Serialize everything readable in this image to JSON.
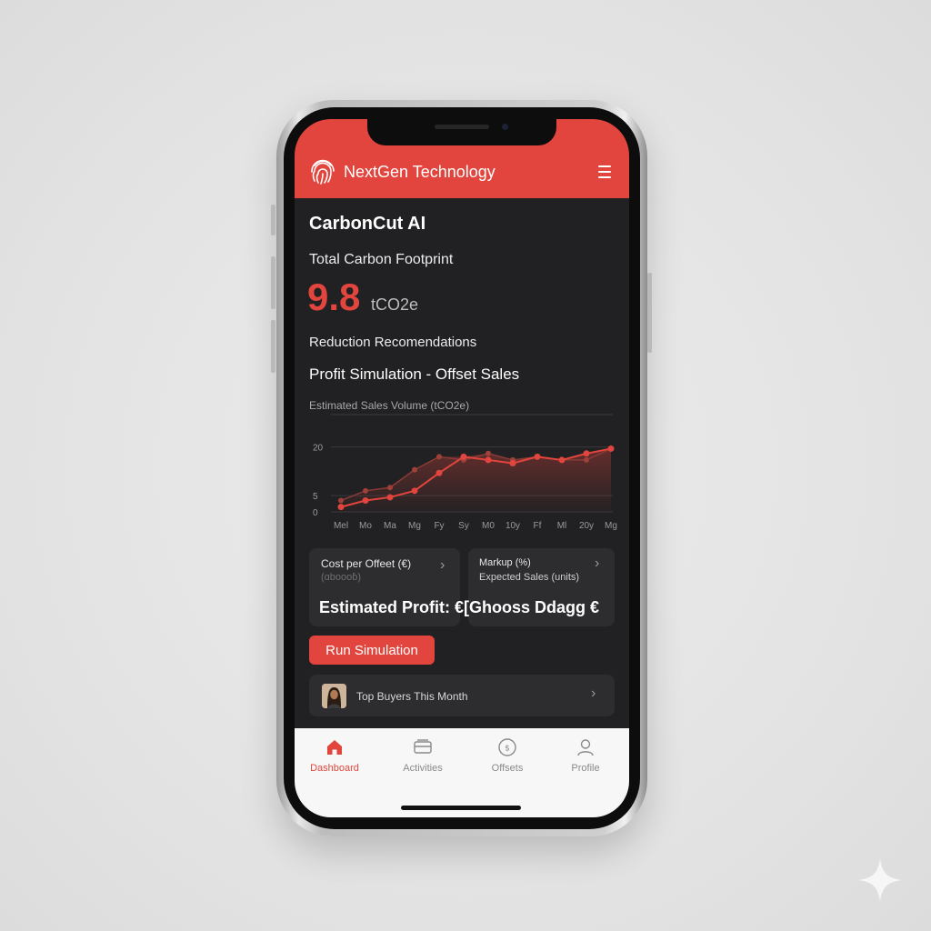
{
  "header": {
    "brand": "NextGen Technology",
    "brand_color": "#e2453d"
  },
  "app": {
    "title": "CarbonCut AI"
  },
  "footprint": {
    "label": "Total Carbon Footprint",
    "value": "9.8",
    "unit": "tCO2e"
  },
  "sections": {
    "reduction": "Reduction Recomendations",
    "simulation_title": "Profit Simulation - Offset Sales"
  },
  "chart_data": {
    "type": "line",
    "title": "",
    "ylabel": "Estimated Sales Volume (tCO2e)",
    "xlabel": "",
    "categories": [
      "Mel",
      "Mo",
      "Ma",
      "Mg",
      "Fy",
      "Sy",
      "M0",
      "10y",
      "Ff",
      "Ml",
      "20y",
      "Mg"
    ],
    "y_ticks": [
      "20",
      "5",
      "0"
    ],
    "ylim": [
      0,
      30
    ],
    "grid": true,
    "series": [
      {
        "values": [
          1.5,
          3.5,
          4.5,
          6.5,
          12,
          17,
          16,
          15,
          17,
          16,
          18,
          19.5
        ]
      },
      {
        "values": [
          3.5,
          6.5,
          7.5,
          13,
          17,
          16,
          18,
          16,
          17,
          16,
          16,
          19.5
        ]
      }
    ]
  },
  "cards": {
    "left": {
      "line1": "Cost per Offeet (€)",
      "line2": "(ɑboooɓ)"
    },
    "right": {
      "line1": "Markup (%)",
      "line2": "Expected Sales (units)"
    },
    "profit": "Estimated Profit: €[Ghooss Ddagg €"
  },
  "actions": {
    "run": "Run Simulation"
  },
  "buyers": {
    "label": "Top Buyers This Month"
  },
  "tabs": [
    {
      "label": "Dashboard",
      "icon": "home-icon",
      "active": true
    },
    {
      "label": "Activities",
      "icon": "activities-icon"
    },
    {
      "label": "Offsets",
      "icon": "offsets-icon"
    },
    {
      "label": "Profile",
      "icon": "profile-icon"
    }
  ],
  "icon_names": [
    "fingerprint-icon",
    "menu-icon",
    "chevron-right-icon",
    "avatar",
    "sparkle-icon"
  ]
}
